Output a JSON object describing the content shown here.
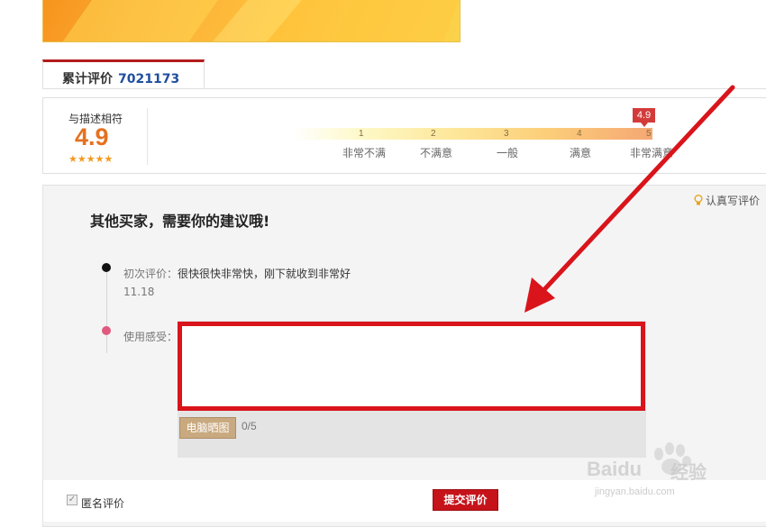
{
  "tab": {
    "label": "累计评价",
    "count": "7021173"
  },
  "rating": {
    "label": "与描述相符",
    "value": "4.9",
    "stars": "★★★★★",
    "badge": "4.9",
    "scale": [
      {
        "num": "1",
        "label": "非常不满"
      },
      {
        "num": "2",
        "label": "不满意"
      },
      {
        "num": "3",
        "label": "一般"
      },
      {
        "num": "4",
        "label": "满意"
      },
      {
        "num": "5",
        "label": "非常满意"
      }
    ],
    "colors": {
      "value": "#e5711f",
      "badge": "#d33b3b"
    }
  },
  "panel": {
    "title": "其他买家，需要你的建议哦!",
    "tip": "认真写评价",
    "tip_icon": "lightbulb-icon",
    "first_review_label": "初次评价：",
    "first_review_text": "很快很快非常快，刚下就收到非常好",
    "first_review_date": "11.18",
    "usage_label": "使用感受：",
    "usage_value": "",
    "upload_label": "电脑晒图",
    "counter": "0/5"
  },
  "footer": {
    "anonymous_label": "匿名评价",
    "anonymous_checked": true,
    "submit_label": "提交评价",
    "submit_color": "#c6131a"
  },
  "annotation": {
    "color": "#d9141b"
  },
  "watermark": {
    "brand": "Baidu",
    "brand_cn": "经验",
    "url": "jingyan.baidu.com"
  }
}
